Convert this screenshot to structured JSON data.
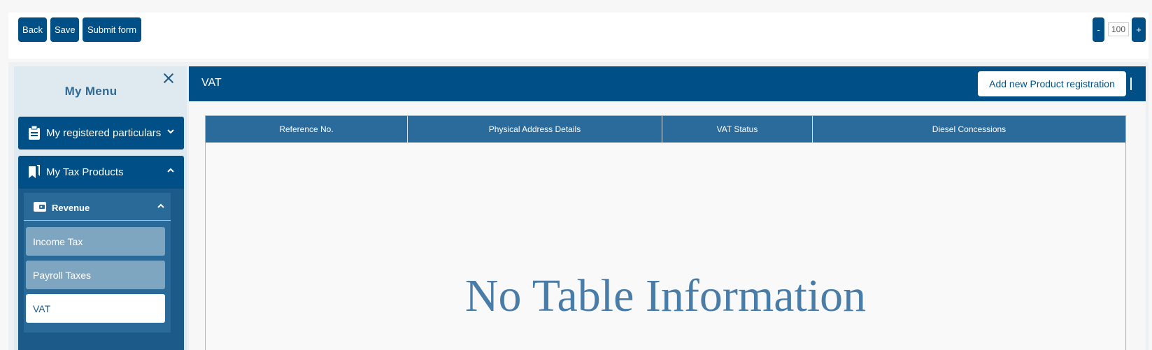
{
  "toolbar": {
    "back_label": "Back",
    "save_label": "Save",
    "submit_label": "Submit form",
    "zoom_minus": "-",
    "zoom_value": "100",
    "zoom_plus": "+"
  },
  "sidebar": {
    "title": "My Menu",
    "panels": [
      {
        "label": "My registered particulars",
        "icon": "clipboard-icon",
        "expanded": false
      },
      {
        "label": "My Tax Products",
        "icon": "bookmark-icon",
        "expanded": true
      }
    ],
    "revenue": {
      "label": "Revenue",
      "icon": "wallet-icon",
      "items": [
        {
          "label": "Income Tax",
          "active": false
        },
        {
          "label": "Payroll Taxes",
          "active": false
        },
        {
          "label": "VAT",
          "active": true
        }
      ]
    }
  },
  "main": {
    "title": "VAT",
    "add_button": "Add new Product registration",
    "table": {
      "columns": [
        "Reference No.",
        "Physical Address Details",
        "VAT Status",
        "Diesel Concessions"
      ],
      "empty_message": "No Table Information"
    }
  },
  "colors": {
    "primary": "#004f86",
    "table_header": "#2b6b9b",
    "sidebar_bg": "#dfe9f0",
    "sub_item": "#7fa6c1",
    "empty_text": "#4a7ca8"
  }
}
